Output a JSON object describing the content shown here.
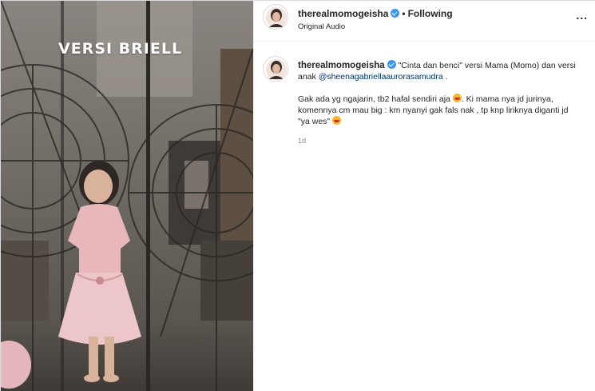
{
  "media": {
    "overlay_text": "VERSI BRIELL"
  },
  "header": {
    "username": "therealmomogeisha",
    "separator": "•",
    "follow_status": "Following",
    "audio": "Original Audio",
    "more": "..."
  },
  "caption": {
    "username": "therealmomogeisha",
    "text_part1": " \"Cinta dan benci\" versi Mama (Momo) dan versi anak ",
    "mention": "@sheenagabriellaaurorasamudra",
    "text_part2": " .",
    "para2_part1": "Gak ada yg ngajarin, tb2 hafal sendiri aja ",
    "para2_part2": ". Ki mama nya jd jurinya, komennya cm mau big : km nyanyi gak fals nak , tp knp liriknya diganti jd \"ya wes\" ",
    "time": "1d"
  },
  "colors": {
    "verified": "#3897f0",
    "mention": "#00376b",
    "muted": "#8e8e8e"
  },
  "icons": {
    "verified": "verified-badge-icon",
    "more": "more-options-icon",
    "emoji": "laughing-emoji-icon"
  }
}
